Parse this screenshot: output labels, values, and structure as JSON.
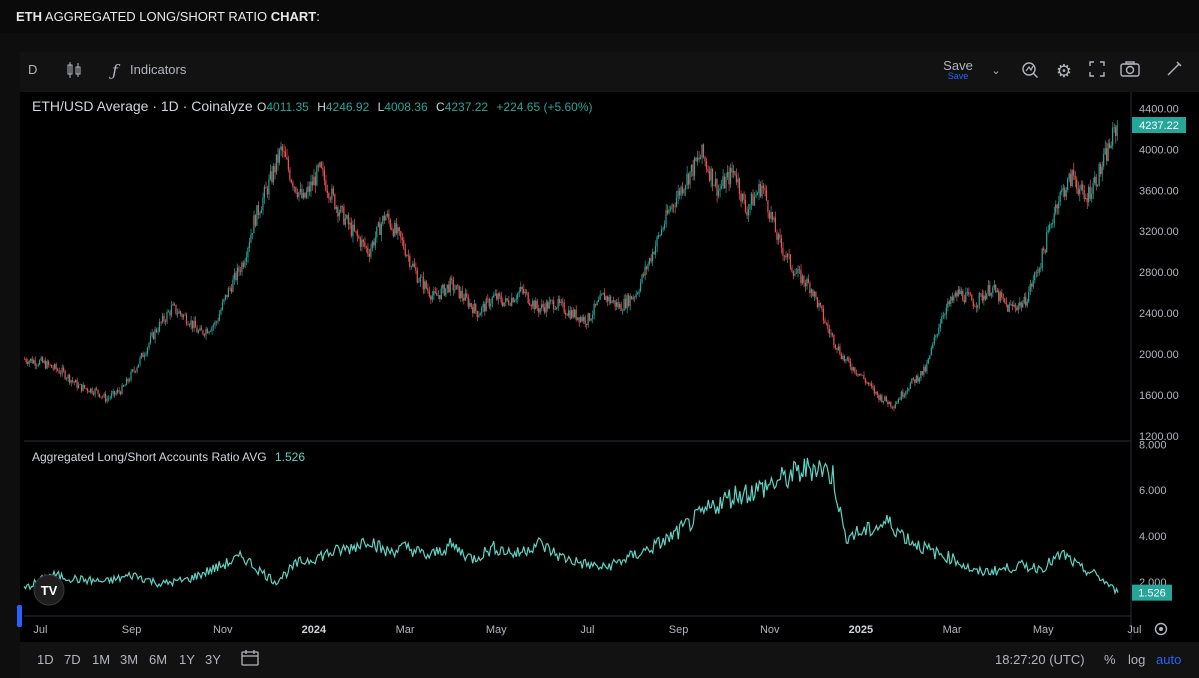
{
  "page_title": {
    "symbol": "ETH",
    "middle": " AGGREGATED LONG/SHORT RATIO ",
    "suffix": "CHART",
    "colon": ":"
  },
  "toolbar": {
    "interval": "D",
    "indicators_label": "Indicators",
    "save_label": "Save",
    "save_sub_label": "Save",
    "icons": [
      "candles-icon",
      "fx-icon",
      "chevron-down-icon",
      "replay-icon",
      "gear-icon",
      "fullscreen-icon",
      "camera-icon",
      "draw-icon"
    ]
  },
  "price_legend": {
    "title": "ETH/USD Average · 1D · Coinalyze",
    "o_label": "O",
    "o": "4011.35",
    "h_label": "H",
    "h": "4246.92",
    "l_label": "L",
    "l": "4008.36",
    "c_label": "C",
    "c": "4237.22",
    "change": "+224.65 (+5.60%)"
  },
  "ratio_legend": {
    "title": "Aggregated Long/Short Accounts Ratio AVG",
    "value": "1.526"
  },
  "bottom_bar": {
    "ranges": [
      "1D",
      "7D",
      "1M",
      "3M",
      "6M",
      "1Y",
      "3Y"
    ],
    "time": "18:27:20 (UTC)",
    "percent": "%",
    "log": "log",
    "auto": "auto"
  },
  "colors": {
    "up": "#26a69a",
    "down": "#ef5350",
    "ratio_line": "#5fd3c4",
    "last_price_bg": "#26a69a",
    "accent": "#2962ff"
  },
  "chart_data": [
    {
      "type": "candlestick",
      "title": "ETH/USD Average · 1D · Coinalyze",
      "x_ticks": [
        "Jul",
        "Sep",
        "Nov",
        "2024",
        "Mar",
        "May",
        "Jul",
        "Sep",
        "Nov",
        "2025",
        "Mar",
        "May",
        "Jul"
      ],
      "x_ticks_bold": [
        "2024",
        "2025"
      ],
      "y_ticks": [
        1200,
        1600,
        2000,
        2400,
        2800,
        3200,
        3600,
        4000,
        4400
      ],
      "y_tick_labels": [
        "1200.00",
        "1600.00",
        "2000.00",
        "2400.00",
        "2800.00",
        "3200.00",
        "3600.00",
        "4000.00",
        "4400.00"
      ],
      "ylim": [
        1160,
        4560
      ],
      "last_value_label": "4237.22",
      "last_value": 4237.22,
      "series": [
        {
          "points": [
            [
              0,
              1950
            ],
            [
              0.03,
              1920
            ],
            [
              0.07,
              1820
            ],
            [
              0.1,
              1680
            ],
            [
              0.13,
              1640
            ],
            [
              0.15,
              1560
            ],
            [
              0.18,
              1660
            ],
            [
              0.21,
              1930
            ],
            [
              0.24,
              2230
            ],
            [
              0.27,
              2450
            ],
            [
              0.3,
              2340
            ],
            [
              0.32,
              2200
            ],
            [
              0.35,
              2300
            ],
            [
              0.37,
              2580
            ],
            [
              0.4,
              2900
            ],
            [
              0.42,
              3300
            ],
            [
              0.45,
              3700
            ],
            [
              0.47,
              4000
            ],
            [
              0.49,
              3700
            ],
            [
              0.51,
              3500
            ],
            [
              0.54,
              3800
            ],
            [
              0.57,
              3460
            ],
            [
              0.6,
              3200
            ],
            [
              0.63,
              3000
            ],
            [
              0.66,
              3360
            ],
            [
              0.69,
              3100
            ],
            [
              0.72,
              2750
            ],
            [
              0.75,
              2550
            ],
            [
              0.78,
              2680
            ],
            [
              0.81,
              2520
            ],
            [
              0.83,
              2400
            ],
            [
              0.86,
              2560
            ],
            [
              0.88,
              2500
            ],
            [
              0.91,
              2620
            ],
            [
              0.94,
              2440
            ],
            [
              0.97,
              2500
            ],
            [
              1.0,
              2400
            ],
            [
              1.03,
              2330
            ],
            [
              1.06,
              2570
            ],
            [
              1.09,
              2460
            ],
            [
              1.12,
              2600
            ],
            [
              1.15,
              3000
            ],
            [
              1.18,
              3400
            ],
            [
              1.21,
              3700
            ],
            [
              1.24,
              3950
            ],
            [
              1.27,
              3600
            ],
            [
              1.3,
              3800
            ],
            [
              1.32,
              3400
            ],
            [
              1.35,
              3650
            ],
            [
              1.38,
              3100
            ],
            [
              1.41,
              2800
            ],
            [
              1.44,
              2650
            ],
            [
              1.47,
              2250
            ],
            [
              1.5,
              1950
            ],
            [
              1.53,
              1800
            ],
            [
              1.56,
              1600
            ],
            [
              1.59,
              1500
            ],
            [
              1.62,
              1700
            ],
            [
              1.65,
              1850
            ],
            [
              1.68,
              2400
            ],
            [
              1.71,
              2600
            ],
            [
              1.74,
              2500
            ],
            [
              1.77,
              2650
            ],
            [
              1.8,
              2450
            ],
            [
              1.83,
              2500
            ],
            [
              1.86,
              2900
            ],
            [
              1.89,
              3500
            ],
            [
              1.92,
              3750
            ],
            [
              1.94,
              3500
            ],
            [
              1.97,
              3800
            ],
            [
              2.0,
              4237
            ]
          ]
        }
      ]
    },
    {
      "type": "line",
      "title": "Aggregated Long/Short Accounts Ratio AVG",
      "y_ticks": [
        2,
        4,
        6,
        8
      ],
      "y_tick_labels": [
        "2.000",
        "4.000",
        "6.000",
        "8.000"
      ],
      "ylim": [
        0.55,
        8.1
      ],
      "last_value_label": "1.526",
      "last_value": 1.526,
      "series": [
        {
          "points": [
            [
              0,
              1.7
            ],
            [
              0.05,
              2.3
            ],
            [
              0.1,
              2.1
            ],
            [
              0.15,
              2.0
            ],
            [
              0.2,
              2.3
            ],
            [
              0.25,
              1.9
            ],
            [
              0.3,
              2.1
            ],
            [
              0.35,
              2.6
            ],
            [
              0.4,
              3.1
            ],
            [
              0.43,
              2.5
            ],
            [
              0.46,
              2.0
            ],
            [
              0.5,
              2.8
            ],
            [
              0.55,
              3.2
            ],
            [
              0.6,
              3.5
            ],
            [
              0.63,
              3.9
            ],
            [
              0.66,
              3.3
            ],
            [
              0.7,
              3.5
            ],
            [
              0.74,
              3.1
            ],
            [
              0.78,
              3.6
            ],
            [
              0.82,
              3.0
            ],
            [
              0.86,
              3.5
            ],
            [
              0.9,
              3.2
            ],
            [
              0.94,
              3.7
            ],
            [
              0.98,
              3.1
            ],
            [
              1.02,
              2.8
            ],
            [
              1.06,
              2.6
            ],
            [
              1.1,
              3.0
            ],
            [
              1.14,
              3.4
            ],
            [
              1.18,
              3.9
            ],
            [
              1.22,
              4.6
            ],
            [
              1.26,
              5.3
            ],
            [
              1.3,
              5.8
            ],
            [
              1.34,
              6.0
            ],
            [
              1.38,
              6.4
            ],
            [
              1.42,
              6.8
            ],
            [
              1.45,
              7.1
            ],
            [
              1.48,
              6.6
            ],
            [
              1.5,
              4.0
            ],
            [
              1.54,
              4.2
            ],
            [
              1.58,
              4.6
            ],
            [
              1.62,
              3.8
            ],
            [
              1.66,
              3.3
            ],
            [
              1.7,
              3.0
            ],
            [
              1.74,
              2.4
            ],
            [
              1.78,
              2.5
            ],
            [
              1.82,
              2.7
            ],
            [
              1.86,
              2.6
            ],
            [
              1.9,
              3.2
            ],
            [
              1.93,
              2.6
            ],
            [
              1.96,
              2.3
            ],
            [
              2.0,
              1.53
            ]
          ]
        }
      ]
    }
  ]
}
